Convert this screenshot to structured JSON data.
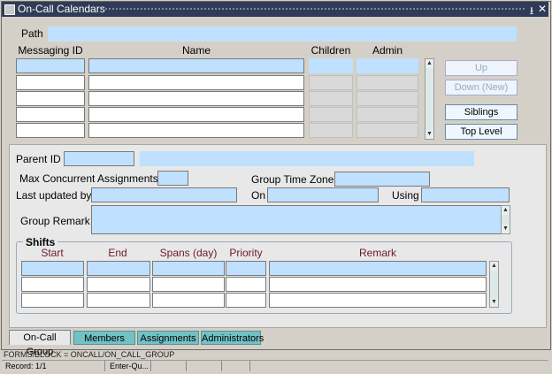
{
  "window": {
    "title": "On-Call Calendars",
    "buttons": {
      "minimize": "⭳",
      "close": "✕"
    }
  },
  "header": {
    "path_label": "Path",
    "columns": {
      "messaging_id": "Messaging ID",
      "name": "Name",
      "children": "Children",
      "admin": "Admin"
    }
  },
  "side_buttons": {
    "up": "Up",
    "down": "Down (New)",
    "siblings": "Siblings",
    "top_level": "Top Level"
  },
  "group": {
    "parent_id_label": "Parent ID",
    "max_concurrent_label": "Max Concurrent Assignments",
    "time_zone_label": "Group Time Zone",
    "last_updated_label": "Last updated by",
    "on_label": "On",
    "using_label": "Using",
    "remark_label": "Group Remark"
  },
  "shifts": {
    "title": "Shifts",
    "columns": {
      "start": "Start",
      "end": "End",
      "spans": "Spans (day)",
      "priority": "Priority",
      "remark": "Remark"
    }
  },
  "tabs": [
    "On-Call Group",
    "Members",
    "Assignments",
    "Administrators"
  ],
  "status": {
    "message": "FORMS/BLOCK = ONCALL/ON_CALL_GROUP",
    "record": "Record: 1/1",
    "mode": "Enter-Qu..."
  }
}
